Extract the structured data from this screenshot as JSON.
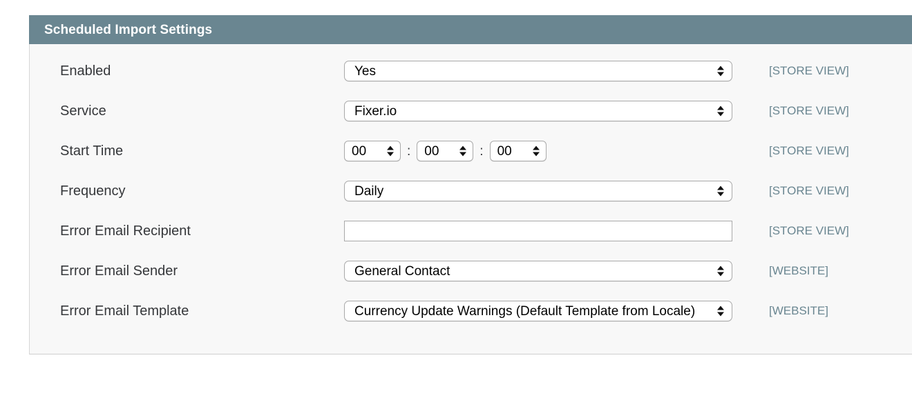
{
  "panel": {
    "title": "Scheduled Import Settings",
    "header_color": "#6a8691",
    "body_color": "#f8f8f8",
    "scope_color": "#6a8691"
  },
  "rows": [
    {
      "label": "Enabled",
      "control": "select",
      "value": "Yes",
      "scope": "[STORE VIEW]"
    },
    {
      "label": "Service",
      "control": "select",
      "value": "Fixer.io",
      "scope": "[STORE VIEW]"
    },
    {
      "label": "Start Time",
      "control": "time",
      "hours": "00",
      "minutes": "00",
      "seconds": "00",
      "separator": ":",
      "scope": "[STORE VIEW]"
    },
    {
      "label": "Frequency",
      "control": "select",
      "value": "Daily",
      "scope": "[STORE VIEW]"
    },
    {
      "label": "Error Email Recipient",
      "control": "text",
      "value": "",
      "placeholder": "",
      "scope": "[STORE VIEW]"
    },
    {
      "label": "Error Email Sender",
      "control": "select",
      "value": "General Contact",
      "scope": "[WEBSITE]"
    },
    {
      "label": "Error Email Template",
      "control": "select",
      "value": "Currency Update Warnings (Default Template from Locale)",
      "scope": "[WEBSITE]"
    }
  ]
}
